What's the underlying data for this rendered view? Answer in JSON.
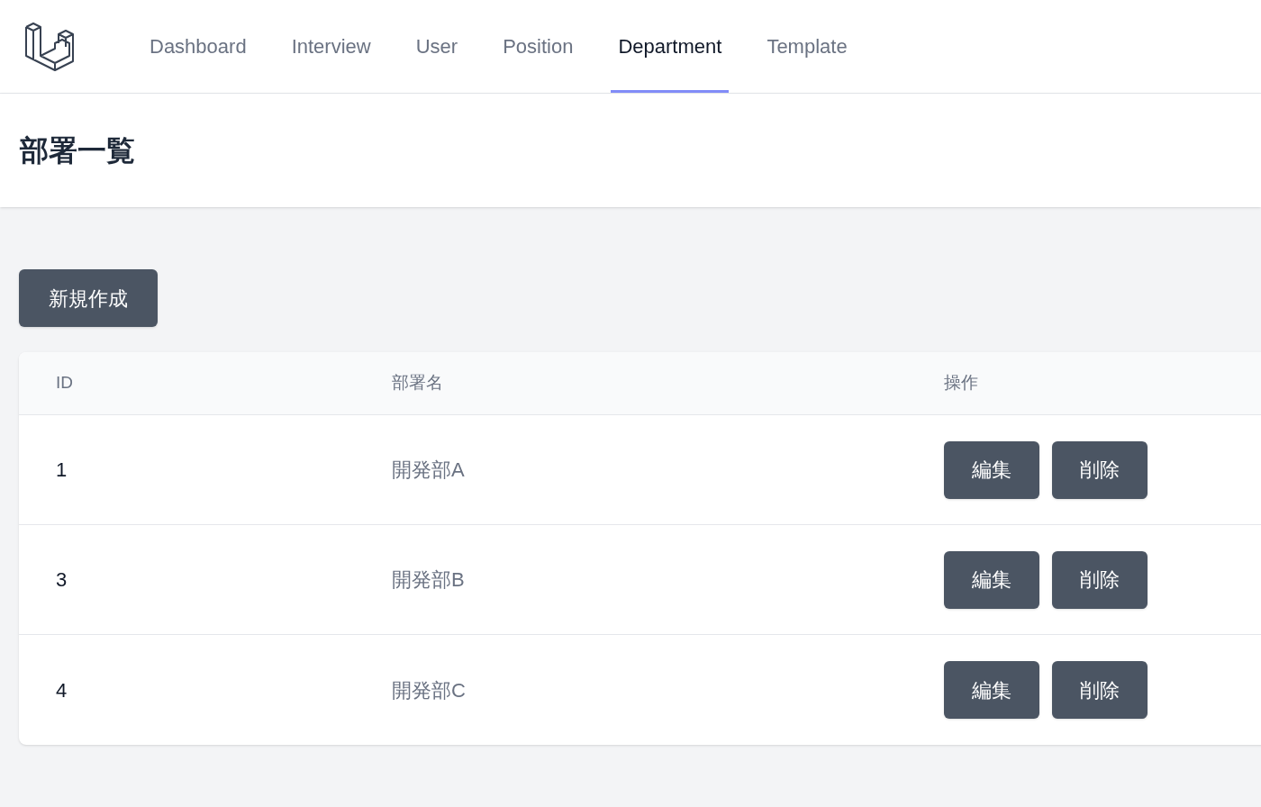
{
  "nav": {
    "items": [
      {
        "label": "Dashboard",
        "selected": false
      },
      {
        "label": "Interview",
        "selected": false
      },
      {
        "label": "User",
        "selected": false
      },
      {
        "label": "Position",
        "selected": false
      },
      {
        "label": "Department",
        "selected": true
      },
      {
        "label": "Template",
        "selected": false
      }
    ]
  },
  "header": {
    "title": "部署一覧"
  },
  "create_button": "新規作成",
  "table": {
    "columns": [
      "ID",
      "部署名",
      "操作"
    ],
    "rows": [
      {
        "id": "1",
        "name": "開発部A",
        "actions": [
          "編集",
          "削除"
        ]
      },
      {
        "id": "3",
        "name": "開発部B",
        "actions": [
          "編集",
          "削除"
        ]
      },
      {
        "id": "4",
        "name": "開発部C",
        "actions": [
          "編集",
          "削除"
        ]
      }
    ]
  }
}
